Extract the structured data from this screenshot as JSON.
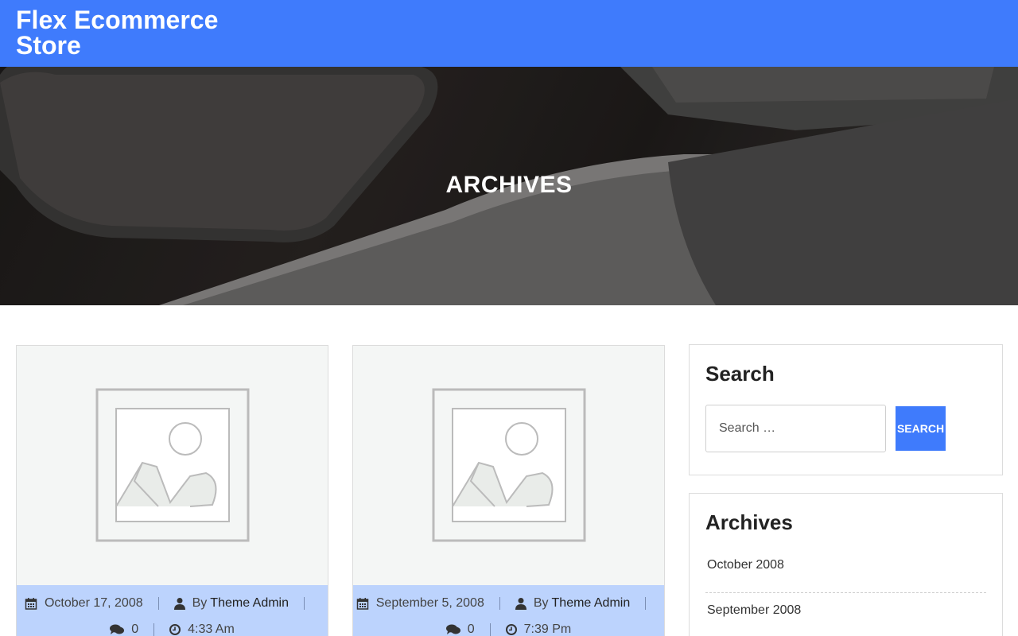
{
  "header": {
    "site_title": "Flex Ecommerce Store"
  },
  "hero": {
    "title": "ARCHIVES"
  },
  "posts": [
    {
      "date": "October 17, 2008",
      "by": "By",
      "author": "Theme Admin",
      "comments": "0",
      "time": "4:33 Am"
    },
    {
      "date": "September 5, 2008",
      "by": "By",
      "author": "Theme Admin",
      "comments": "0",
      "time": "7:39 Pm"
    }
  ],
  "sidebar": {
    "search": {
      "title": "Search",
      "placeholder": "Search …",
      "button_label": "Search"
    },
    "archives": {
      "title": "Archives",
      "items": [
        "October 2008",
        "September 2008"
      ]
    }
  },
  "colors": {
    "accent": "#3f7bfc",
    "meta_bg": "#bcd3fd"
  },
  "icons": [
    "calendar-icon",
    "user-icon",
    "comments-icon",
    "clock-icon",
    "image-placeholder-icon"
  ]
}
